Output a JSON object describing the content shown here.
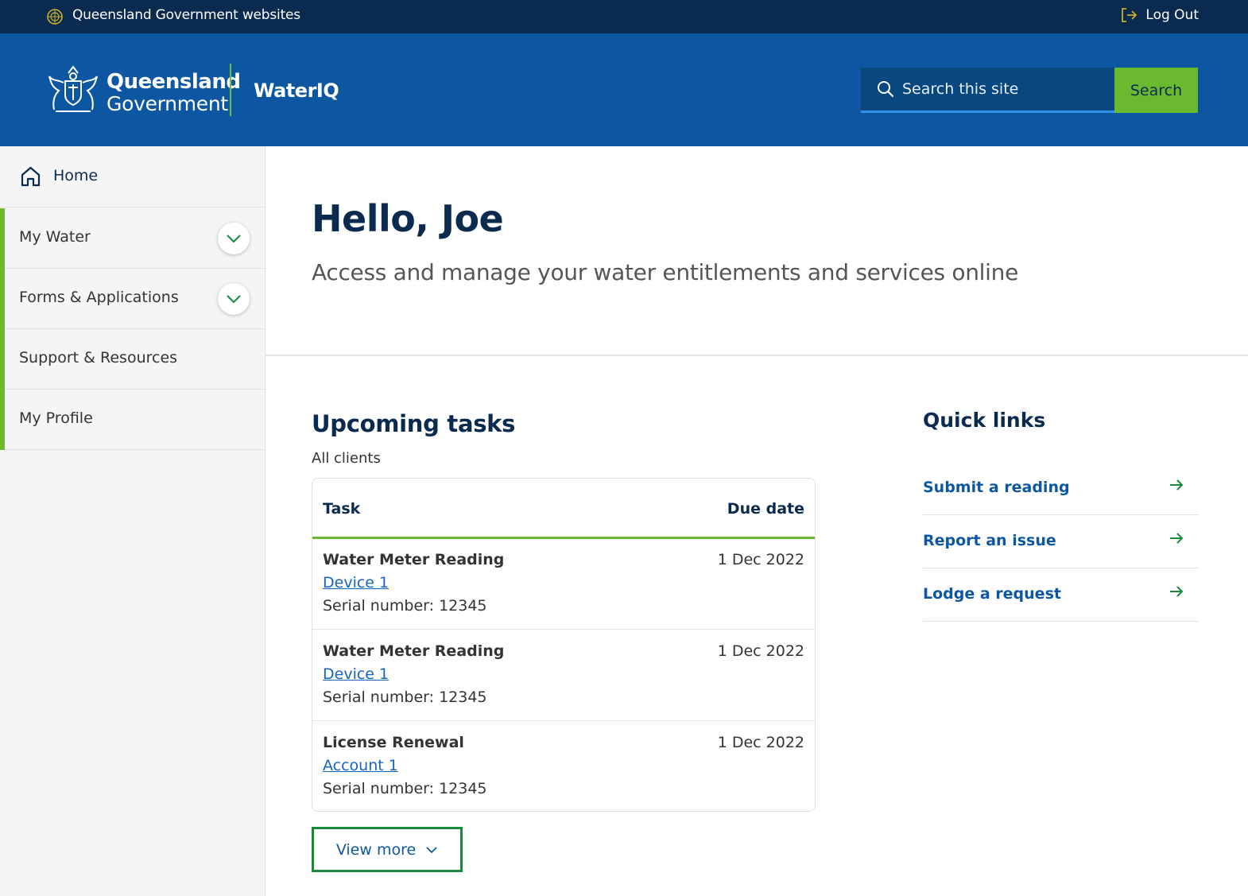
{
  "topbar": {
    "sites_label": "Queensland Government websites",
    "logout_label": "Log Out"
  },
  "header": {
    "org_line1": "Queensland",
    "org_line2": "Government",
    "app_name": "WaterIQ",
    "search": {
      "placeholder": "Search this site",
      "button_label": "Search"
    }
  },
  "sidebar": {
    "home_label": "Home",
    "items": [
      {
        "label": "My Water",
        "expandable": true
      },
      {
        "label": "Forms & Applications",
        "expandable": true
      },
      {
        "label": "Support & Resources",
        "expandable": false
      },
      {
        "label": "My Profile",
        "expandable": false
      }
    ]
  },
  "hero": {
    "title": "Hello, Joe",
    "subtitle": "Access and manage your water entitlements and services online"
  },
  "tasks": {
    "title": "Upcoming tasks",
    "filter_label": "All clients",
    "columns": {
      "task": "Task",
      "due_date": "Due date"
    },
    "rows": [
      {
        "name": "Water Meter Reading",
        "link": "Device 1",
        "serial": "Serial number: 12345",
        "due": "1 Dec 2022"
      },
      {
        "name": "Water Meter Reading",
        "link": "Device 1",
        "serial": "Serial number: 12345",
        "due": "1 Dec 2022"
      },
      {
        "name": "License Renewal",
        "link": "Account 1",
        "serial": "Serial number: 12345",
        "due": "1 Dec 2022"
      }
    ],
    "view_more_label": "View more"
  },
  "quick_links": {
    "title": "Quick links",
    "items": [
      {
        "label": "Submit a reading"
      },
      {
        "label": "Report an issue"
      },
      {
        "label": "Lodge a request"
      }
    ]
  },
  "colors": {
    "topbar_bg": "#0a2a4f",
    "header_bg": "#0d57a2",
    "accent_green": "#6bb92e",
    "link_blue": "#1565c0",
    "heading_navy": "#0a2a4f"
  },
  "icons": [
    "globe-icon",
    "logout-icon",
    "qld-crest-logo",
    "search-icon",
    "home-icon",
    "chevron-down-icon",
    "arrow-right-icon"
  ]
}
